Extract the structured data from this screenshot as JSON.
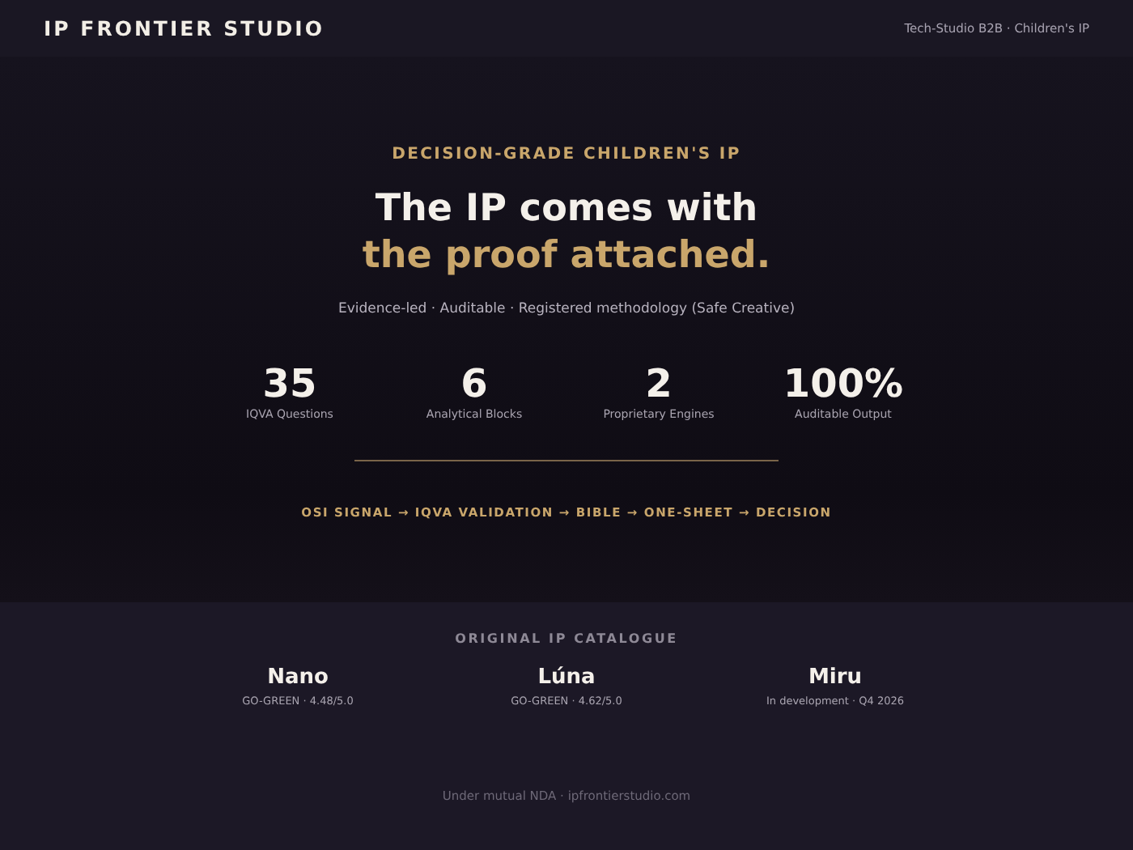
{
  "header": {
    "brand": "IP FRONTIER STUDIO",
    "tagline": "Tech-Studio B2B · Children's IP"
  },
  "hero": {
    "eyebrow": "DECISION-GRADE CHILDREN'S IP",
    "title_line_1": "The IP comes with",
    "title_line_2": "the proof attached.",
    "subtitle": "Evidence-led · Auditable · Registered methodology (Safe Creative)",
    "stats": [
      {
        "value": "35",
        "label": "IQVA Questions"
      },
      {
        "value": "6",
        "label": "Analytical Blocks"
      },
      {
        "value": "2",
        "label": "Proprietary Engines"
      },
      {
        "value": "100%",
        "label": "Auditable Output"
      }
    ],
    "process": "OSI SIGNAL → IQVA VALIDATION → BIBLE → ONE-SHEET → DECISION"
  },
  "catalogue": {
    "heading": "ORIGINAL IP CATALOGUE",
    "items": [
      {
        "name": "Nano",
        "status": "GO-GREEN · 4.48/5.0"
      },
      {
        "name": "Lúna",
        "status": "GO-GREEN · 4.62/5.0"
      },
      {
        "name": "Miru",
        "status": "In development · Q4 2026"
      }
    ]
  },
  "footer": "Under mutual NDA · ipfrontierstudio.com"
}
